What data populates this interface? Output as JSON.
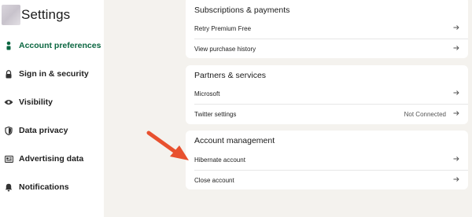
{
  "sidebar": {
    "title": "Settings",
    "items": [
      {
        "label": "Account preferences",
        "icon": "person-icon",
        "active": true
      },
      {
        "label": "Sign in & security",
        "icon": "lock-icon"
      },
      {
        "label": "Visibility",
        "icon": "eye-icon"
      },
      {
        "label": "Data privacy",
        "icon": "shield-icon"
      },
      {
        "label": "Advertising data",
        "icon": "newspaper-icon"
      },
      {
        "label": "Notifications",
        "icon": "bell-icon"
      }
    ]
  },
  "sections": {
    "subscriptions": {
      "title": "Subscriptions & payments",
      "rows": [
        {
          "label": "Retry Premium Free"
        },
        {
          "label": "View purchase history"
        }
      ]
    },
    "partners": {
      "title": "Partners & services",
      "rows": [
        {
          "label": "Microsoft"
        },
        {
          "label": "Twitter settings",
          "status": "Not Connected"
        }
      ]
    },
    "account_management": {
      "title": "Account management",
      "rows": [
        {
          "label": "Hibernate account"
        },
        {
          "label": "Close account"
        }
      ]
    }
  },
  "colors": {
    "accent": "#0a6640",
    "background": "#f4f2ee",
    "annotation": "#e8512f"
  }
}
